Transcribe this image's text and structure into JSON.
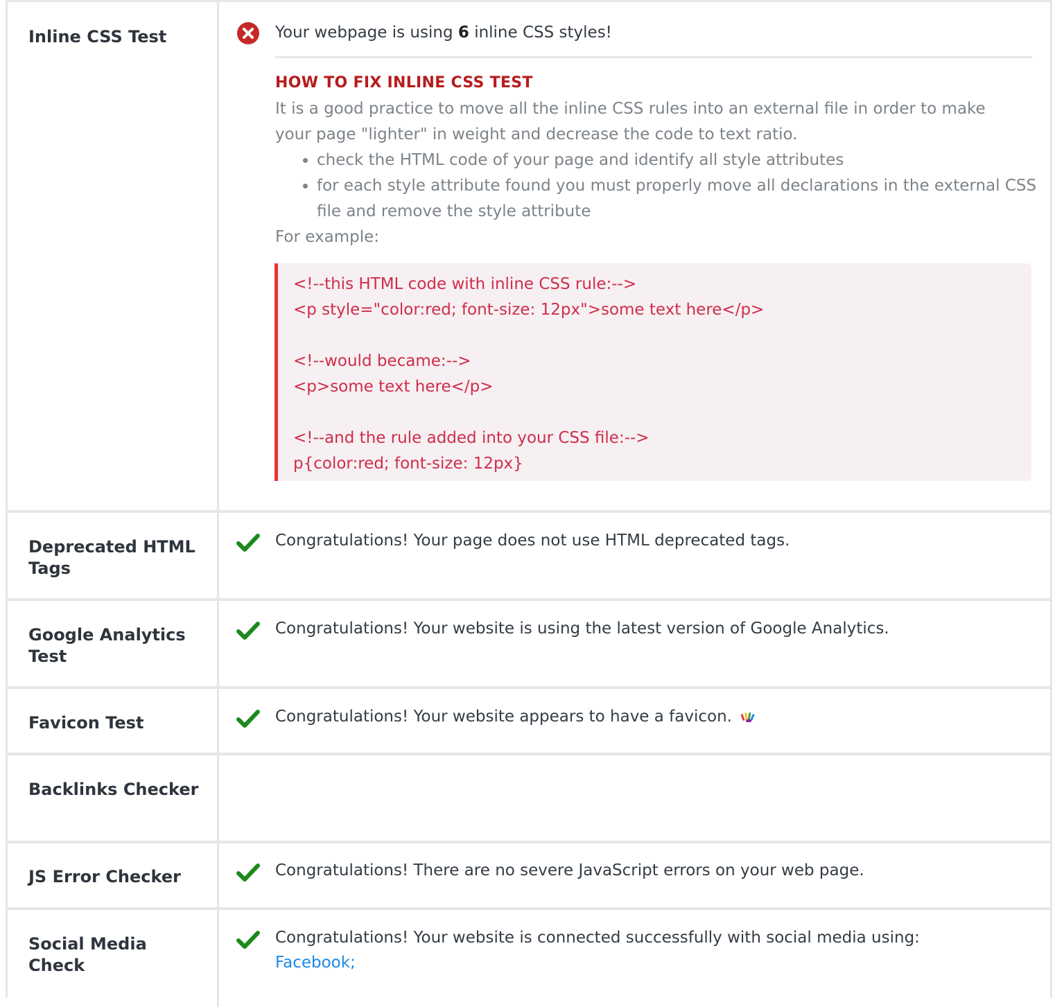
{
  "rows": {
    "inline_css": {
      "label": "Inline CSS Test",
      "status": "fail",
      "message_before": "Your webpage is using",
      "message_count": "6",
      "message_after": "inline CSS styles!",
      "fix_title": "HOW TO FIX INLINE CSS TEST",
      "fix_text": "It is a good practice to move all the inline CSS rules into an external file in order to make your page \"lighter\" in weight and decrease the code to text ratio.",
      "fix_steps": [
        "check the HTML code of your page and identify all style attributes",
        "for each style attribute found you must properly move all declarations in the external CSS file and remove the style attribute"
      ],
      "example_label": "For example:",
      "code_example": "<!--this HTML code with inline CSS rule:-->\n<p style=\"color:red; font-size: 12px\">some text here</p>\n\n<!--would became:-->\n<p>some text here</p>\n\n<!--and the rule added into your CSS file:-->\np{color:red; font-size: 12px}"
    },
    "deprecated_tags": {
      "label": "Deprecated HTML Tags",
      "status": "pass",
      "message": "Congratulations! Your page does not use HTML deprecated tags."
    },
    "google_analytics": {
      "label": "Google Analytics Test",
      "status": "pass",
      "message": "Congratulations! Your website is using the latest version of Google Analytics."
    },
    "favicon": {
      "label": "Favicon Test",
      "status": "pass",
      "message": "Congratulations! Your website appears to have a favicon."
    },
    "backlinks": {
      "label": "Backlinks Checker",
      "status": "none",
      "message": ""
    },
    "js_errors": {
      "label": "JS Error Checker",
      "status": "pass",
      "message": "Congratulations! There are no severe JavaScript errors on your web page."
    },
    "social_media": {
      "label": "Social Media Check",
      "status": "pass",
      "message": "Congratulations! Your website is connected successfully with social media using:",
      "networks": "Facebook;"
    }
  },
  "colors": {
    "fail": "#c62828",
    "pass": "#1b8a1b",
    "fix_title": "#b71c1c",
    "link": "#1e88e5",
    "code_text": "#cf2d4a",
    "code_border": "#e63535"
  },
  "icons": {
    "fail": "x-circle-icon",
    "pass": "checkmark-icon",
    "favicon": "site-favicon-icon"
  }
}
